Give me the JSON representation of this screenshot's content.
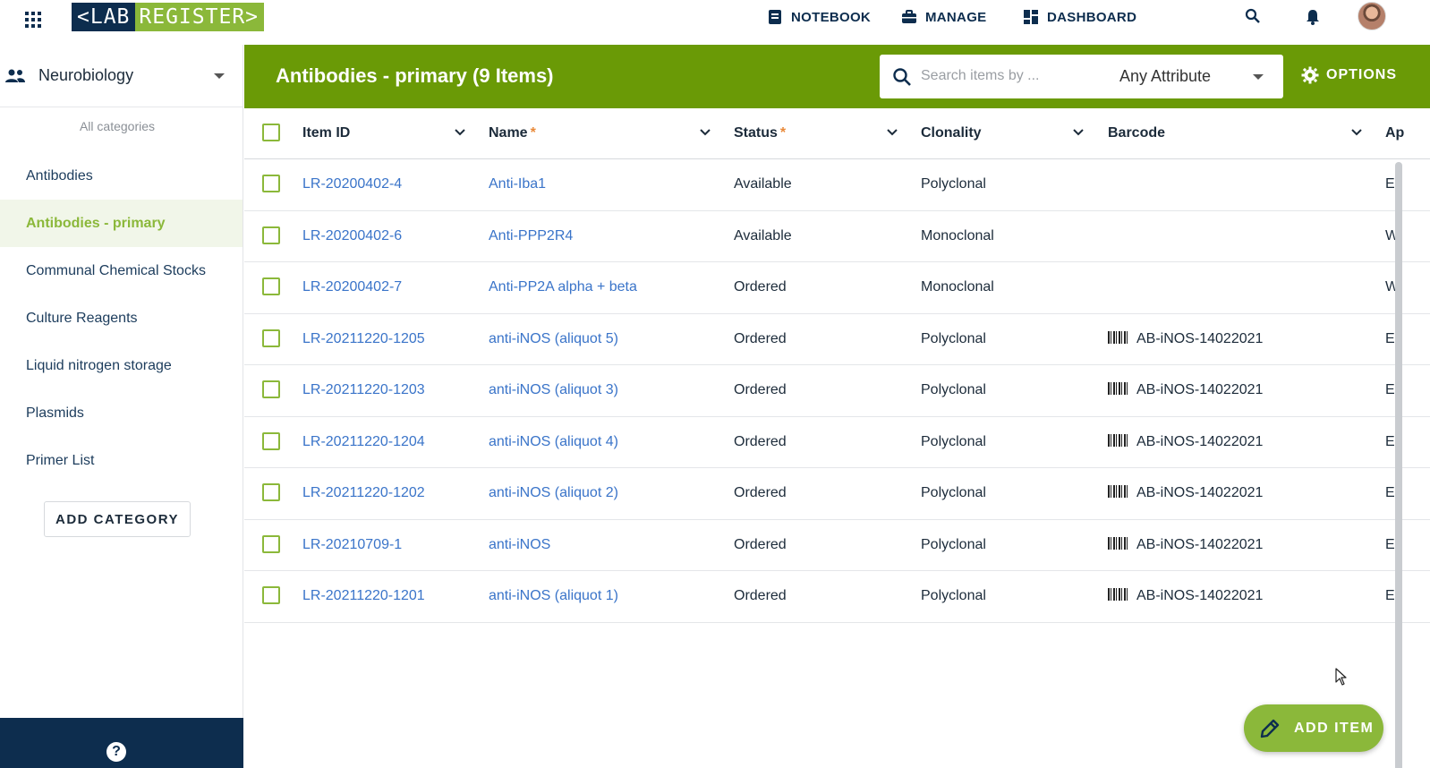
{
  "logo": {
    "part1": "<LAB",
    "part2": "REGISTER>"
  },
  "topnav": {
    "notebook": "NOTEBOOK",
    "manage": "MANAGE",
    "dashboard": "DASHBOARD"
  },
  "sidebar": {
    "group": "Neurobiology",
    "all_categories": "All categories",
    "categories": [
      {
        "label": "Antibodies"
      },
      {
        "label": "Antibodies - primary",
        "active": true
      },
      {
        "label": "Communal Chemical Stocks"
      },
      {
        "label": "Culture Reagents"
      },
      {
        "label": "Liquid nitrogen storage"
      },
      {
        "label": "Plasmids"
      },
      {
        "label": "Primer List"
      }
    ],
    "add_category": "ADD CATEGORY",
    "help": "?"
  },
  "header": {
    "title": "Antibodies - primary (9 Items)",
    "search_placeholder": "Search items by ...",
    "attribute": "Any Attribute",
    "options": "OPTIONS"
  },
  "table": {
    "columns": {
      "item_id": "Item ID",
      "name": "Name",
      "status": "Status",
      "clonality": "Clonality",
      "barcode": "Barcode",
      "next": "Ap"
    },
    "required_mark": "*",
    "rows": [
      {
        "id": "LR-20200402-4",
        "name": "Anti-Iba1",
        "status": "Available",
        "clonality": "Polyclonal",
        "barcode": "",
        "next": "E"
      },
      {
        "id": "LR-20200402-6",
        "name": "Anti-PPP2R4",
        "status": "Available",
        "clonality": "Monoclonal",
        "barcode": "",
        "next": "W"
      },
      {
        "id": "LR-20200402-7",
        "name": "Anti-PP2A alpha + beta",
        "status": "Ordered",
        "clonality": "Monoclonal",
        "barcode": "",
        "next": "W"
      },
      {
        "id": "LR-20211220-1205",
        "name": "anti-iNOS (aliquot 5)",
        "status": "Ordered",
        "clonality": "Polyclonal",
        "barcode": "AB-iNOS-14022021",
        "next": "E"
      },
      {
        "id": "LR-20211220-1203",
        "name": "anti-iNOS (aliquot 3)",
        "status": "Ordered",
        "clonality": "Polyclonal",
        "barcode": "AB-iNOS-14022021",
        "next": "E"
      },
      {
        "id": "LR-20211220-1204",
        "name": "anti-iNOS (aliquot 4)",
        "status": "Ordered",
        "clonality": "Polyclonal",
        "barcode": "AB-iNOS-14022021",
        "next": "E"
      },
      {
        "id": "LR-20211220-1202",
        "name": "anti-iNOS (aliquot 2)",
        "status": "Ordered",
        "clonality": "Polyclonal",
        "barcode": "AB-iNOS-14022021",
        "next": "E"
      },
      {
        "id": "LR-20210709-1",
        "name": "anti-iNOS",
        "status": "Ordered",
        "clonality": "Polyclonal",
        "barcode": "AB-iNOS-14022021",
        "next": "E"
      },
      {
        "id": "LR-20211220-1201",
        "name": "anti-iNOS (aliquot 1)",
        "status": "Ordered",
        "clonality": "Polyclonal",
        "barcode": "AB-iNOS-14022021",
        "next": "E"
      }
    ]
  },
  "add_item": "ADD ITEM",
  "colors": {
    "brand_navy": "#0d2d4e",
    "brand_green": "#8bb83a",
    "header_green": "#6a9a06",
    "link_blue": "#3a74c9",
    "required_orange": "#e98a3a"
  },
  "icons": [
    "apps-grid-icon",
    "notebook-icon",
    "briefcase-icon",
    "dashboard-icon",
    "search-icon",
    "bell-icon",
    "group-icon",
    "gear-icon",
    "chevron-down-icon",
    "barcode-icon",
    "pencil-icon",
    "help-icon"
  ]
}
